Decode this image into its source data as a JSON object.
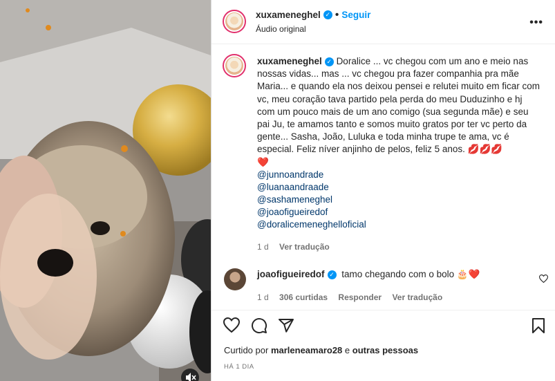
{
  "post": {
    "author": "xuxameneghel",
    "follow_label": "Seguir",
    "audio": "Áudio original",
    "more": "•••"
  },
  "caption": {
    "author": "xuxameneghel",
    "text": "Doralice ... vc chegou com um ano e meio nas nossas vidas... mas ... vc chegou pra fazer companhia pra mãe Maria... e quando ela nos deixou pensei e relutei muito em ficar com vc, meu coração tava partido pela perda do meu Duduzinho e hj com um pouco mais de um ano comigo (sua segunda mãe) e seu pai Ju, te amamos tanto e somos muito gratos por ter vc perto da gente... Sasha, João, Luluka e toda minha trupe te ama, vc é especial. Feliz níver anjinho de pelos, feliz 5 anos. 💋💋💋",
    "heart": "❤️",
    "mentions": [
      "@junnoandrade",
      "@luanaandraade",
      "@sashameneghel",
      "@joaofigueiredof",
      "@doralicemeneghelloficial"
    ],
    "age": "1 d",
    "translate": "Ver tradução"
  },
  "comment": {
    "author": "joaofigueiredof",
    "text": "tamo chegando com o bolo 🎂❤️",
    "age": "1 d",
    "likes": "306 curtidas",
    "reply": "Responder",
    "translate": "Ver tradução"
  },
  "footer": {
    "liked_prefix": "Curtido por",
    "liked_user": "marleneamaro28",
    "liked_and": "e",
    "liked_others": "outras pessoas",
    "time": "HÁ 1 DIA"
  },
  "icons": {
    "like": "heart-icon",
    "comment": "comment-icon",
    "share": "share-icon",
    "save": "bookmark-icon",
    "mute": "muted-speaker-icon",
    "comment_like": "heart-icon",
    "options": "more-options-icon",
    "verified": "verified-badge-icon"
  },
  "colors": {
    "link": "#00376b",
    "follow": "#0095f6",
    "verified": "#0095f6",
    "muted_text": "#737373"
  }
}
